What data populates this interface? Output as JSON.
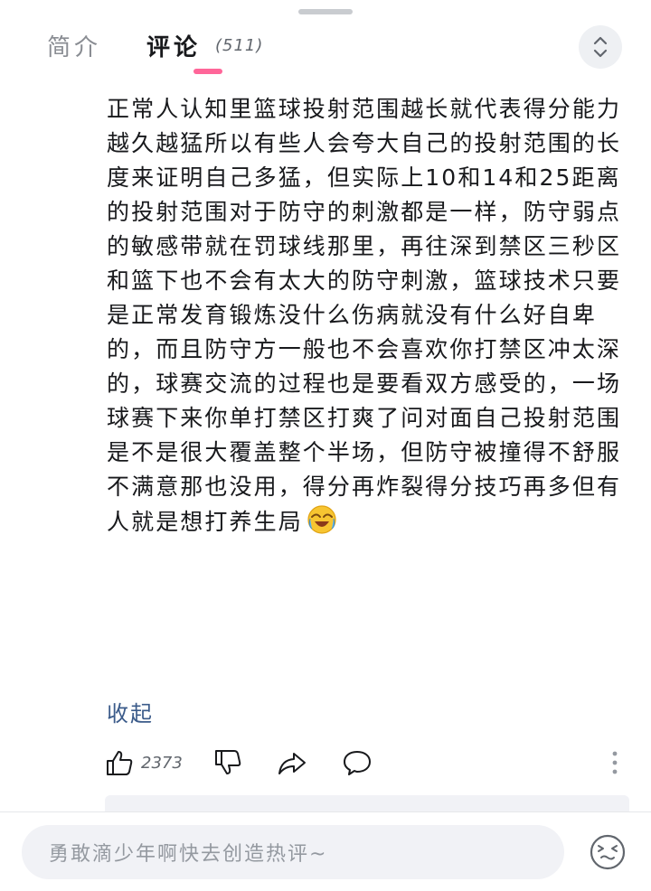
{
  "tabs": {
    "intro": "简介",
    "comments": "评论",
    "comment_count": "(511)"
  },
  "comment": {
    "text": "正常人认知里篮球投射范围越长就代表得分能力越久越猛所以有些人会夸大自己的投射范围的长度来证明自己多猛，但实际上10和14和25距离的投射范围对于防守的刺激都是一样，防守弱点的敏感带就在罚球线那里，再往深到禁区三秒区和篮下也不会有太大的防守刺激，篮球技术只要是正常发育锻炼没什么伤病就没有什么好自卑的，而且防守方一般也不会喜欢你打禁区冲太深的，球赛交流的过程也是要看双方感受的，一场球赛下来你单打禁区打爽了问对面自己投射范围是不是很大覆盖整个半场，但防守被撞得不舒服不满意那也没用，得分再炸裂得分技巧再多但有人就是想打养生局",
    "emoji": "laughing-crying-emoji",
    "collapse_label": "收起"
  },
  "actions": {
    "like_count": "2373",
    "icons": [
      "thumbs-up-icon",
      "thumbs-down-icon",
      "share-icon",
      "reply-icon",
      "more-icon"
    ]
  },
  "input": {
    "placeholder": "勇敢滴少年啊快去创造热评~"
  },
  "colors": {
    "accent_pink": "#ff6699",
    "link_blue": "#3b5b8a",
    "muted_gray": "#9499a0"
  }
}
